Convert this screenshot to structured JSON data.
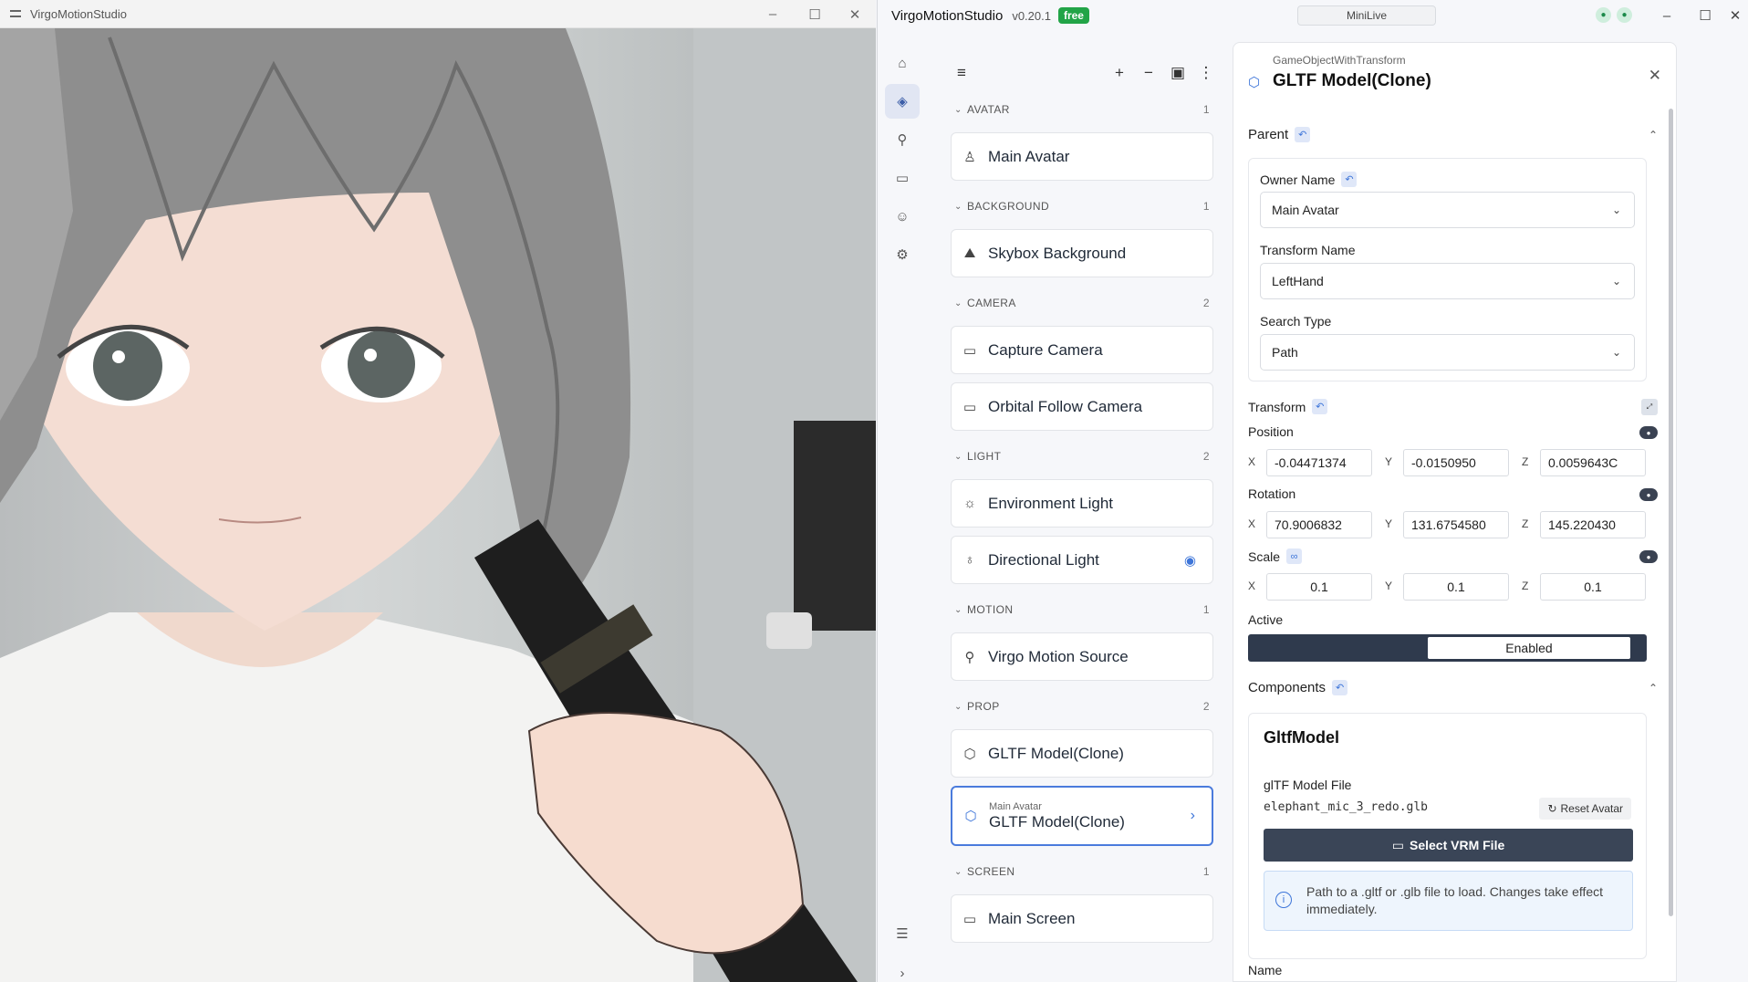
{
  "viewport_window": {
    "title": "VirgoMotionStudio"
  },
  "app": {
    "name": "VirgoMotionStudio",
    "version": "v0.20.1",
    "badge": "free",
    "mini_live_label": "MiniLive"
  },
  "toolbar": {
    "list_icon": "list-icon",
    "add_icon": "plus-icon",
    "remove_icon": "minus-icon",
    "save_icon": "save-icon",
    "more_icon": "more-vert-icon"
  },
  "sections": [
    {
      "label": "AVATAR",
      "count": "1",
      "items": [
        {
          "label": "Main Avatar",
          "icon": "person-icon"
        }
      ]
    },
    {
      "label": "BACKGROUND",
      "count": "1",
      "items": [
        {
          "label": "Skybox Background",
          "icon": "mountain-icon"
        }
      ]
    },
    {
      "label": "CAMERA",
      "count": "2",
      "items": [
        {
          "label": "Capture Camera",
          "icon": "video-icon"
        },
        {
          "label": "Orbital Follow Camera",
          "icon": "video-icon"
        }
      ]
    },
    {
      "label": "LIGHT",
      "count": "2",
      "items": [
        {
          "label": "Environment Light",
          "icon": "sun-icon"
        },
        {
          "label": "Directional Light",
          "icon": "bulb-icon"
        }
      ]
    },
    {
      "label": "MOTION",
      "count": "1",
      "items": [
        {
          "label": "Virgo Motion Source",
          "icon": "figure-icon"
        }
      ]
    },
    {
      "label": "PROP",
      "count": "2",
      "items": [
        {
          "label": "GLTF Model(Clone)",
          "icon": "cube-icon"
        },
        {
          "label": "GLTF Model(Clone)",
          "sublabel": "Main Avatar",
          "icon": "cube-icon",
          "selected": true
        }
      ]
    },
    {
      "label": "SCREEN",
      "count": "1",
      "items": [
        {
          "label": "Main Screen",
          "icon": "monitor-icon"
        }
      ]
    }
  ],
  "inspector": {
    "type": "GameObjectWithTransform",
    "title": "GLTF Model(Clone)",
    "parent": {
      "label": "Parent",
      "owner_label": "Owner Name",
      "owner_value": "Main Avatar",
      "transform_label": "Transform Name",
      "transform_value": "LeftHand",
      "search_label": "Search Type",
      "search_value": "Path"
    },
    "transform": {
      "label": "Transform",
      "position_label": "Position",
      "rotation_label": "Rotation",
      "scale_label": "Scale",
      "position": {
        "x": "-0.04471374",
        "y": "-0.0150950",
        "z": "0.0059643C"
      },
      "rotation": {
        "x": "70.9006832",
        "y": "131.6754580",
        "z": "145.220430"
      },
      "scale": {
        "x": "0.1",
        "y": "0.1",
        "z": "0.1"
      }
    },
    "active": {
      "label": "Active",
      "value": "Enabled"
    },
    "components": {
      "label": "Components",
      "card_title": "GltfModel",
      "file_label": "glTF Model File",
      "file_name": "elephant_mic_3_redo.glb",
      "reset_label": "Reset Avatar",
      "select_label": "Select VRM File",
      "info_text": "Path to a .gltf or .glb file to load. Changes take effect immediately."
    },
    "name_label": "Name"
  },
  "axes": {
    "x": "X",
    "y": "Y",
    "z": "Z"
  },
  "colors": {
    "accent": "#3d75d9",
    "badge_green": "#22a447",
    "dark_button": "#3a4557"
  }
}
